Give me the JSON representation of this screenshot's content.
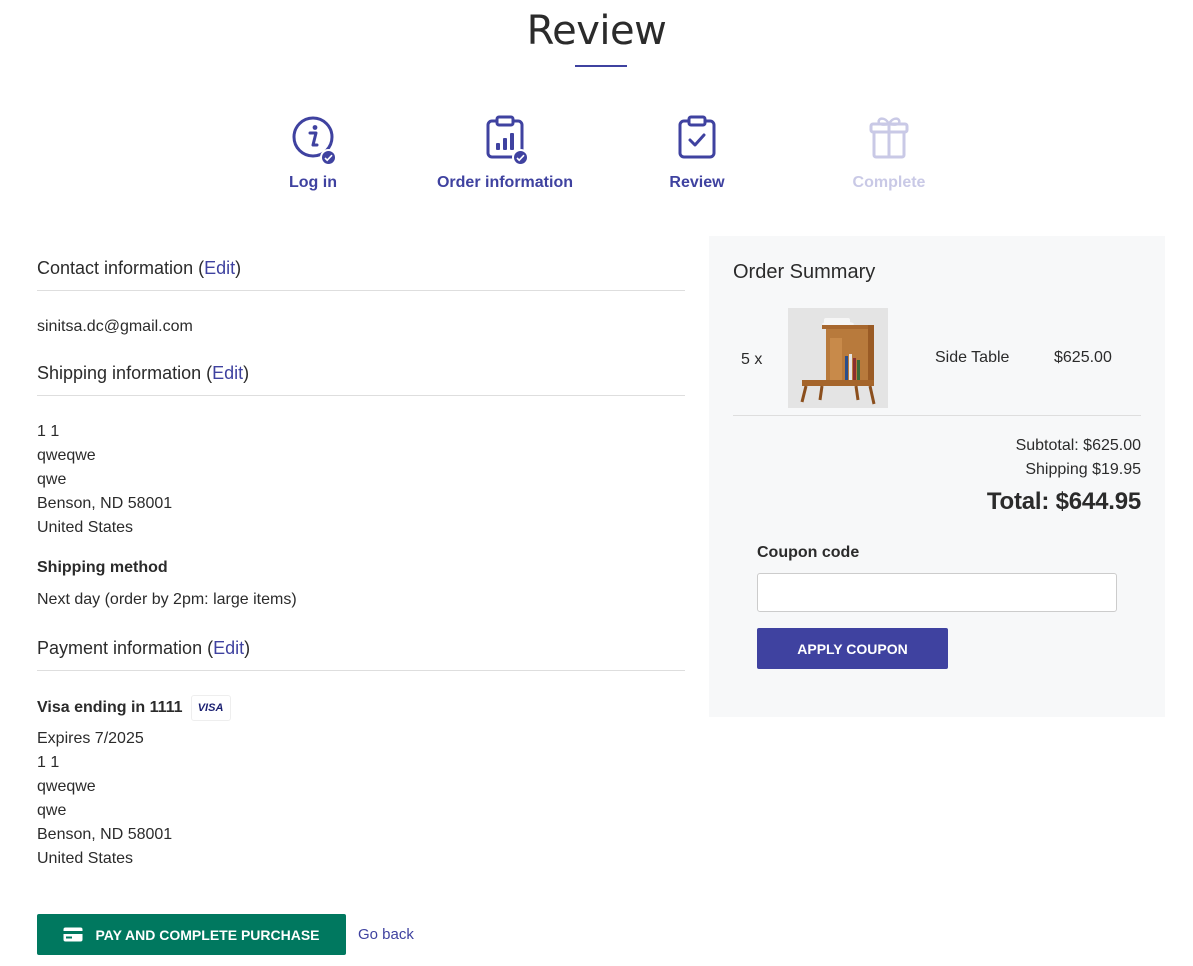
{
  "page": {
    "title": "Review"
  },
  "steps": [
    {
      "label": "Log in",
      "icon": "info-icon",
      "completed": true
    },
    {
      "label": "Order information",
      "icon": "clipboard-chart-icon",
      "completed": true
    },
    {
      "label": "Review",
      "icon": "clipboard-check-icon",
      "completed": false,
      "active": true
    },
    {
      "label": "Complete",
      "icon": "gift-icon",
      "completed": false,
      "disabled": true
    }
  ],
  "contact": {
    "heading": "Contact information (",
    "edit": "Edit",
    "heading_close": ")",
    "email": "sinitsa.dc@gmail.com"
  },
  "shipping": {
    "heading": "Shipping information (",
    "edit": "Edit",
    "heading_close": ")",
    "address": [
      "1 1",
      "qweqwe",
      "qwe",
      "Benson, ND 58001",
      "United States"
    ],
    "method_label": "Shipping method",
    "method_value": "Next day (order by 2pm: large items)"
  },
  "payment": {
    "heading": "Payment information (",
    "edit": "Edit",
    "heading_close": ")",
    "card": "Visa ending in 1111",
    "card_brand": "VISA",
    "expires": "Expires 7/2025",
    "address": [
      "1 1",
      "qweqwe",
      "qwe",
      "Benson, ND 58001",
      "United States"
    ]
  },
  "actions": {
    "pay_label": "PAY AND COMPLETE PURCHASE",
    "go_back": "Go back"
  },
  "summary": {
    "title": "Order Summary",
    "items": [
      {
        "qty": "5 x",
        "name": "Side Table",
        "price": "$625.00"
      }
    ],
    "subtotal": "Subtotal: $625.00",
    "shipping": "Shipping $19.95",
    "total": "Total: $644.95",
    "coupon_label": "Coupon code",
    "coupon_value": "",
    "apply_label": "APPLY COUPON"
  },
  "colors": {
    "accent": "#3f42a0",
    "pay_button": "#00785f",
    "summary_bg": "#f7f8f9",
    "disabled": "#c9c9e6"
  }
}
